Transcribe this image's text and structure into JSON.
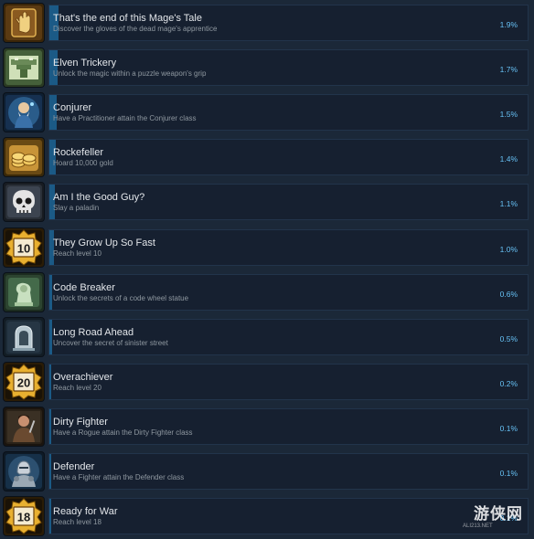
{
  "achievements": [
    {
      "name": "That's the end of this Mage's Tale",
      "description": "Discover the gloves of the dead mage's apprentice",
      "percent_label": "1.9%",
      "percent": 1.9,
      "icon": "glove-hand-icon"
    },
    {
      "name": "Elven Trickery",
      "description": "Unlock the magic within a puzzle weapon's grip",
      "percent_label": "1.7%",
      "percent": 1.7,
      "icon": "puzzle-weapon-icon"
    },
    {
      "name": "Conjurer",
      "description": "Have a Practitioner attain the Conjurer class",
      "percent_label": "1.5%",
      "percent": 1.5,
      "icon": "conjurer-portrait-icon"
    },
    {
      "name": "Rockefeller",
      "description": "Hoard 10,000 gold",
      "percent_label": "1.4%",
      "percent": 1.4,
      "icon": "gold-coins-icon"
    },
    {
      "name": "Am I the Good Guy?",
      "description": "Slay a paladin",
      "percent_label": "1.1%",
      "percent": 1.1,
      "icon": "skull-icon"
    },
    {
      "name": "They Grow Up So Fast",
      "description": "Reach level 10",
      "percent_label": "1.0%",
      "percent": 1.0,
      "icon": "level-badge-icon",
      "badge": "10"
    },
    {
      "name": "Code Breaker",
      "description": "Unlock the secrets of a code wheel statue",
      "percent_label": "0.6%",
      "percent": 0.6,
      "icon": "code-wheel-statue-icon"
    },
    {
      "name": "Long Road Ahead",
      "description": "Uncover the secret of sinister street",
      "percent_label": "0.5%",
      "percent": 0.5,
      "icon": "tombstone-icon"
    },
    {
      "name": "Overachiever",
      "description": "Reach level 20",
      "percent_label": "0.2%",
      "percent": 0.2,
      "icon": "level-badge-icon",
      "badge": "20"
    },
    {
      "name": "Dirty Fighter",
      "description": "Have a Rogue attain the Dirty Fighter class",
      "percent_label": "0.1%",
      "percent": 0.1,
      "icon": "rogue-portrait-icon"
    },
    {
      "name": "Defender",
      "description": "Have a Fighter attain the Defender class",
      "percent_label": "0.1%",
      "percent": 0.1,
      "icon": "knight-portrait-icon"
    },
    {
      "name": "Ready for War",
      "description": "Reach level 18",
      "percent_label": "0.1%",
      "percent": 0.1,
      "icon": "level-badge-icon",
      "badge": "18"
    }
  ],
  "watermark": {
    "text": "游侠网",
    "url": "ALI213.NET"
  },
  "colors": {
    "background": "#1b2838",
    "bar_background": "#162030",
    "bar_fill": "#1b5a86",
    "name_text": "#e3e6ea",
    "description_text": "#8f98a0",
    "percent_text": "#66c0f4"
  }
}
